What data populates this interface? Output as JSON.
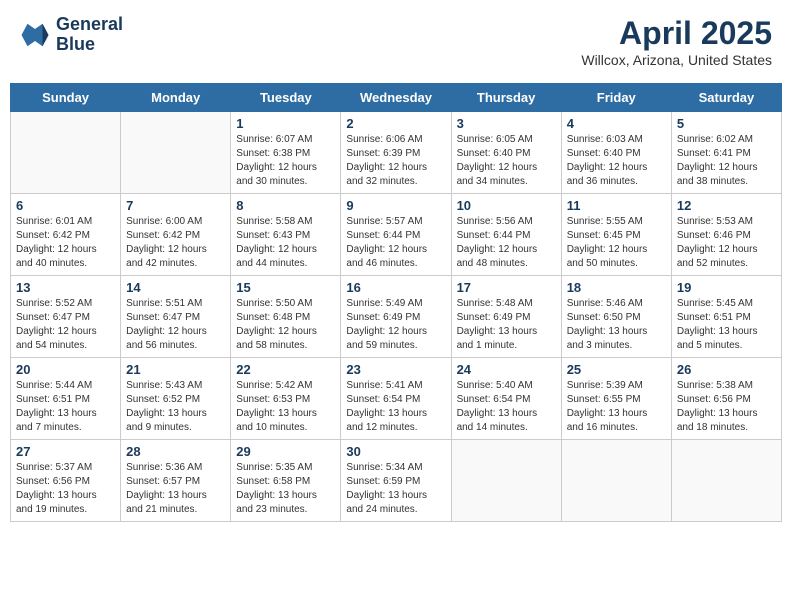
{
  "header": {
    "logo_text_1": "General",
    "logo_text_2": "Blue",
    "title": "April 2025",
    "subtitle": "Willcox, Arizona, United States"
  },
  "days_of_week": [
    "Sunday",
    "Monday",
    "Tuesday",
    "Wednesday",
    "Thursday",
    "Friday",
    "Saturday"
  ],
  "weeks": [
    [
      {
        "day": "",
        "info": ""
      },
      {
        "day": "",
        "info": ""
      },
      {
        "day": "1",
        "info": "Sunrise: 6:07 AM\nSunset: 6:38 PM\nDaylight: 12 hours\nand 30 minutes."
      },
      {
        "day": "2",
        "info": "Sunrise: 6:06 AM\nSunset: 6:39 PM\nDaylight: 12 hours\nand 32 minutes."
      },
      {
        "day": "3",
        "info": "Sunrise: 6:05 AM\nSunset: 6:40 PM\nDaylight: 12 hours\nand 34 minutes."
      },
      {
        "day": "4",
        "info": "Sunrise: 6:03 AM\nSunset: 6:40 PM\nDaylight: 12 hours\nand 36 minutes."
      },
      {
        "day": "5",
        "info": "Sunrise: 6:02 AM\nSunset: 6:41 PM\nDaylight: 12 hours\nand 38 minutes."
      }
    ],
    [
      {
        "day": "6",
        "info": "Sunrise: 6:01 AM\nSunset: 6:42 PM\nDaylight: 12 hours\nand 40 minutes."
      },
      {
        "day": "7",
        "info": "Sunrise: 6:00 AM\nSunset: 6:42 PM\nDaylight: 12 hours\nand 42 minutes."
      },
      {
        "day": "8",
        "info": "Sunrise: 5:58 AM\nSunset: 6:43 PM\nDaylight: 12 hours\nand 44 minutes."
      },
      {
        "day": "9",
        "info": "Sunrise: 5:57 AM\nSunset: 6:44 PM\nDaylight: 12 hours\nand 46 minutes."
      },
      {
        "day": "10",
        "info": "Sunrise: 5:56 AM\nSunset: 6:44 PM\nDaylight: 12 hours\nand 48 minutes."
      },
      {
        "day": "11",
        "info": "Sunrise: 5:55 AM\nSunset: 6:45 PM\nDaylight: 12 hours\nand 50 minutes."
      },
      {
        "day": "12",
        "info": "Sunrise: 5:53 AM\nSunset: 6:46 PM\nDaylight: 12 hours\nand 52 minutes."
      }
    ],
    [
      {
        "day": "13",
        "info": "Sunrise: 5:52 AM\nSunset: 6:47 PM\nDaylight: 12 hours\nand 54 minutes."
      },
      {
        "day": "14",
        "info": "Sunrise: 5:51 AM\nSunset: 6:47 PM\nDaylight: 12 hours\nand 56 minutes."
      },
      {
        "day": "15",
        "info": "Sunrise: 5:50 AM\nSunset: 6:48 PM\nDaylight: 12 hours\nand 58 minutes."
      },
      {
        "day": "16",
        "info": "Sunrise: 5:49 AM\nSunset: 6:49 PM\nDaylight: 12 hours\nand 59 minutes."
      },
      {
        "day": "17",
        "info": "Sunrise: 5:48 AM\nSunset: 6:49 PM\nDaylight: 13 hours\nand 1 minute."
      },
      {
        "day": "18",
        "info": "Sunrise: 5:46 AM\nSunset: 6:50 PM\nDaylight: 13 hours\nand 3 minutes."
      },
      {
        "day": "19",
        "info": "Sunrise: 5:45 AM\nSunset: 6:51 PM\nDaylight: 13 hours\nand 5 minutes."
      }
    ],
    [
      {
        "day": "20",
        "info": "Sunrise: 5:44 AM\nSunset: 6:51 PM\nDaylight: 13 hours\nand 7 minutes."
      },
      {
        "day": "21",
        "info": "Sunrise: 5:43 AM\nSunset: 6:52 PM\nDaylight: 13 hours\nand 9 minutes."
      },
      {
        "day": "22",
        "info": "Sunrise: 5:42 AM\nSunset: 6:53 PM\nDaylight: 13 hours\nand 10 minutes."
      },
      {
        "day": "23",
        "info": "Sunrise: 5:41 AM\nSunset: 6:54 PM\nDaylight: 13 hours\nand 12 minutes."
      },
      {
        "day": "24",
        "info": "Sunrise: 5:40 AM\nSunset: 6:54 PM\nDaylight: 13 hours\nand 14 minutes."
      },
      {
        "day": "25",
        "info": "Sunrise: 5:39 AM\nSunset: 6:55 PM\nDaylight: 13 hours\nand 16 minutes."
      },
      {
        "day": "26",
        "info": "Sunrise: 5:38 AM\nSunset: 6:56 PM\nDaylight: 13 hours\nand 18 minutes."
      }
    ],
    [
      {
        "day": "27",
        "info": "Sunrise: 5:37 AM\nSunset: 6:56 PM\nDaylight: 13 hours\nand 19 minutes."
      },
      {
        "day": "28",
        "info": "Sunrise: 5:36 AM\nSunset: 6:57 PM\nDaylight: 13 hours\nand 21 minutes."
      },
      {
        "day": "29",
        "info": "Sunrise: 5:35 AM\nSunset: 6:58 PM\nDaylight: 13 hours\nand 23 minutes."
      },
      {
        "day": "30",
        "info": "Sunrise: 5:34 AM\nSunset: 6:59 PM\nDaylight: 13 hours\nand 24 minutes."
      },
      {
        "day": "",
        "info": ""
      },
      {
        "day": "",
        "info": ""
      },
      {
        "day": "",
        "info": ""
      }
    ]
  ]
}
